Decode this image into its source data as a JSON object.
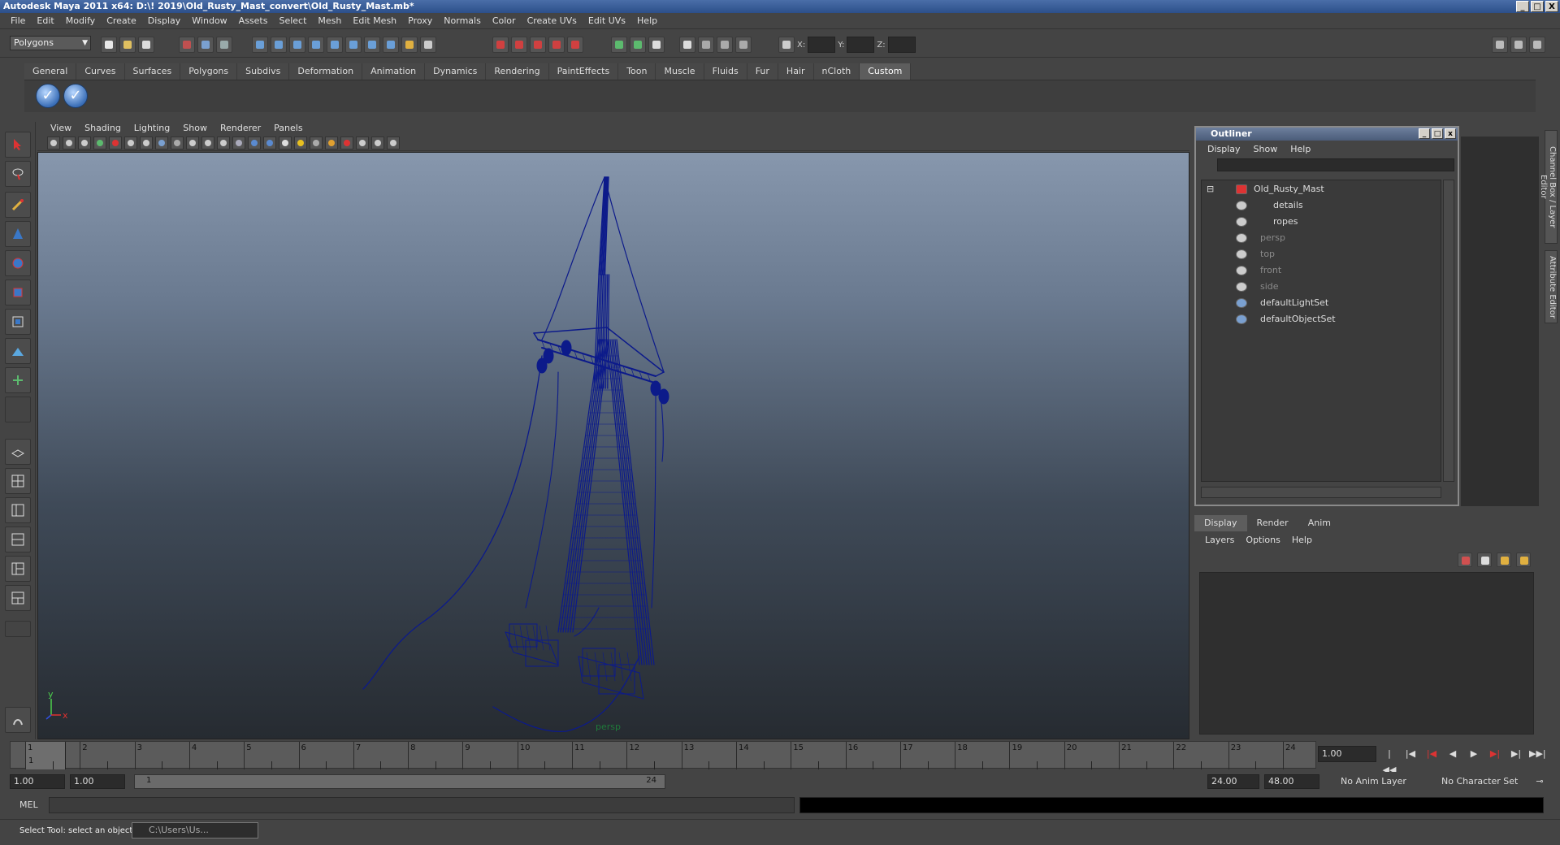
{
  "window": {
    "title": "Autodesk Maya 2011 x64: D:\\! 2019\\Old_Rusty_Mast_convert\\Old_Rusty_Mast.mb*",
    "minimize": "_",
    "maximize": "□",
    "close": "X"
  },
  "menubar": [
    "File",
    "Edit",
    "Modify",
    "Create",
    "Display",
    "Window",
    "Assets",
    "Select",
    "Mesh",
    "Edit Mesh",
    "Proxy",
    "Normals",
    "Color",
    "Create UVs",
    "Edit UVs",
    "Help"
  ],
  "statusline": {
    "mode": "Polygons",
    "x_label": "X:",
    "y_label": "Y:",
    "z_label": "Z:"
  },
  "shelf_tabs": [
    "General",
    "Curves",
    "Surfaces",
    "Polygons",
    "Subdivs",
    "Deformation",
    "Animation",
    "Dynamics",
    "Rendering",
    "PaintEffects",
    "Toon",
    "Muscle",
    "Fluids",
    "Fur",
    "Hair",
    "nCloth",
    "Custom"
  ],
  "shelf_active": "Custom",
  "viewport": {
    "menu": [
      "View",
      "Shading",
      "Lighting",
      "Show",
      "Renderer",
      "Panels"
    ],
    "camera_label": "persp",
    "axis_y": "y",
    "axis_x": "x",
    "wire_color": "#0c1a8a"
  },
  "outliner": {
    "title": "Outliner",
    "menu": [
      "Display",
      "Show",
      "Help"
    ],
    "items": [
      {
        "label": "Old_Rusty_Mast",
        "dim": false
      },
      {
        "label": "details",
        "dim": false
      },
      {
        "label": "ropes",
        "dim": false
      },
      {
        "label": "persp",
        "dim": true
      },
      {
        "label": "top",
        "dim": true
      },
      {
        "label": "front",
        "dim": true
      },
      {
        "label": "side",
        "dim": true
      },
      {
        "label": "defaultLightSet",
        "dim": false
      },
      {
        "label": "defaultObjectSet",
        "dim": false
      }
    ]
  },
  "side_tabs": [
    "Channel Box / Layer Editor",
    "Attribute Editor"
  ],
  "layer_editor": {
    "tabs": [
      "Display",
      "Render",
      "Anim"
    ],
    "menu": [
      "Layers",
      "Options",
      "Help"
    ]
  },
  "timeline": {
    "frames": [
      "1",
      "2",
      "3",
      "4",
      "5",
      "6",
      "7",
      "8",
      "9",
      "10",
      "11",
      "12",
      "13",
      "14",
      "15",
      "16",
      "17",
      "18",
      "19",
      "20",
      "21",
      "22",
      "23",
      "24"
    ],
    "current_marker": "1",
    "current_frame": "1.00"
  },
  "range": {
    "start": "1.00",
    "playback_start": "1.00",
    "slider_left": "1",
    "slider_right": "24",
    "playback_end": "24.00",
    "end": "48.00",
    "anim_layer": "No Anim Layer",
    "char_set": "No Character Set"
  },
  "cmdline": {
    "label": "MEL"
  },
  "helpline": {
    "text": "Select Tool: select an object",
    "task": "C:\\Users\\Us..."
  }
}
